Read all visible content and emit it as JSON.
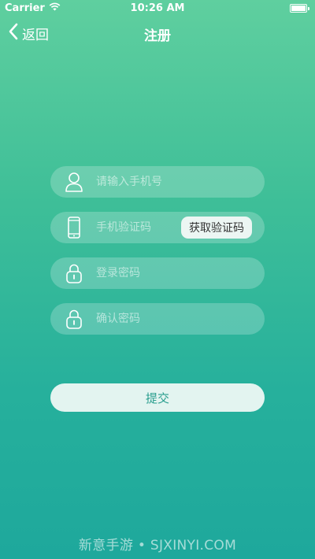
{
  "status_bar": {
    "carrier": "Carrier",
    "time": "10:26 AM"
  },
  "nav": {
    "back_label": "返回",
    "title": "注册"
  },
  "form": {
    "phone_placeholder": "请输入手机号",
    "code_placeholder": "手机验证码",
    "get_code_label": "获取验证码",
    "password_placeholder": "登录密码",
    "confirm_placeholder": "确认密码",
    "submit_label": "提交"
  },
  "watermark": {
    "text": "新意手游 • SJXINYI.COM"
  },
  "colors": {
    "gradient_top": "#5fcf9f",
    "gradient_bottom": "#1ea89c",
    "submit_text": "#2a9e8e",
    "button_bg": "#e3f4f0"
  },
  "icons": [
    "wifi-icon",
    "battery-icon",
    "chevron-left-icon",
    "user-icon",
    "phone-icon",
    "lock-icon"
  ]
}
